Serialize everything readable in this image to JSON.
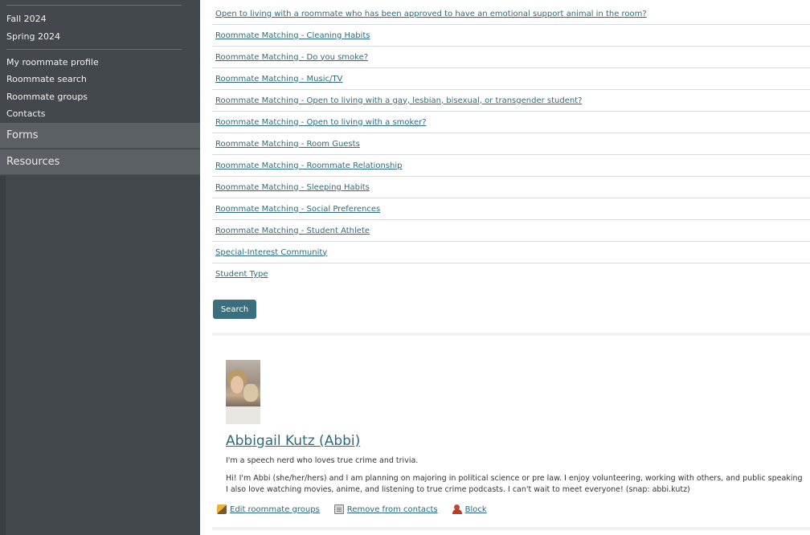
{
  "sidebar": {
    "terms": [
      "Fall 2024",
      "Spring 2024"
    ],
    "roommate_links": [
      "My roommate profile",
      "Roommate search",
      "Roommate groups",
      "Contacts"
    ],
    "sections": [
      "Forms",
      "Resources"
    ]
  },
  "filters": [
    "Open to living with a roommate who has been approved to have an emotional support animal in the room?",
    "Roommate Matching - Cleaning Habits",
    "Roommate Matching - Do you smoke?",
    "Roommate Matching - Music/TV",
    "Roommate Matching - Open to living with a gay, lesbian, bisexual, or transgender student?",
    "Roommate Matching - Open to living with a smoker?",
    "Roommate Matching - Room Guests",
    "Roommate Matching - Roommate Relationship",
    "Roommate Matching - Sleeping Habits",
    "Roommate Matching - Social Preferences",
    "Roommate Matching - Student Athlete",
    "Special-Interest Community",
    "Student Type"
  ],
  "search_label": "Search",
  "profile": {
    "name": "Abbigail Kutz (Abbi)",
    "tagline": "I'm a speech nerd who loves true crime and trivia.",
    "bio_line1": "Hi! I'm Abbi (she/her/hers) and I am planning on majoring in political science or pre law. I enjoy volunteering, working with others, and public speaking",
    "bio_line2": "I also love watching movies, anime, and listening to true crime podcasts. I can't wait to meet everyone! (snap: abbi.kutz)",
    "actions": {
      "edit_groups": "Edit roommate groups",
      "remove_contacts": "Remove from contacts",
      "block": "Block"
    }
  },
  "colors": {
    "sidebar_bg": "#42484c",
    "link": "#2d6a7d",
    "button": "#3c6f7d"
  }
}
